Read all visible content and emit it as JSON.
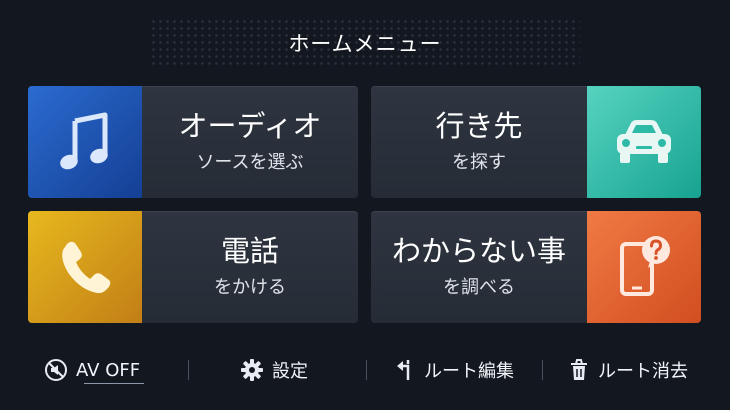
{
  "header": {
    "title": "ホームメニュー"
  },
  "tiles": {
    "audio": {
      "main": "オーディオ",
      "sub": "ソースを選ぶ",
      "icon": "music-note-icon",
      "color": "#1f56b8"
    },
    "destination": {
      "main": "行き先",
      "sub": "を探す",
      "icon": "car-icon",
      "color": "#2dbba7"
    },
    "phone": {
      "main": "電話",
      "sub": "をかける",
      "icon": "phone-handset-icon",
      "color": "#d89c1a"
    },
    "help": {
      "main": "わからない事",
      "sub": "を調べる",
      "icon": "smartphone-question-icon",
      "color": "#e0602c"
    }
  },
  "bottom_bar": {
    "av_off": "AV OFF",
    "settings": "設定",
    "route_edit": "ルート編集",
    "route_delete": "ルート消去"
  }
}
